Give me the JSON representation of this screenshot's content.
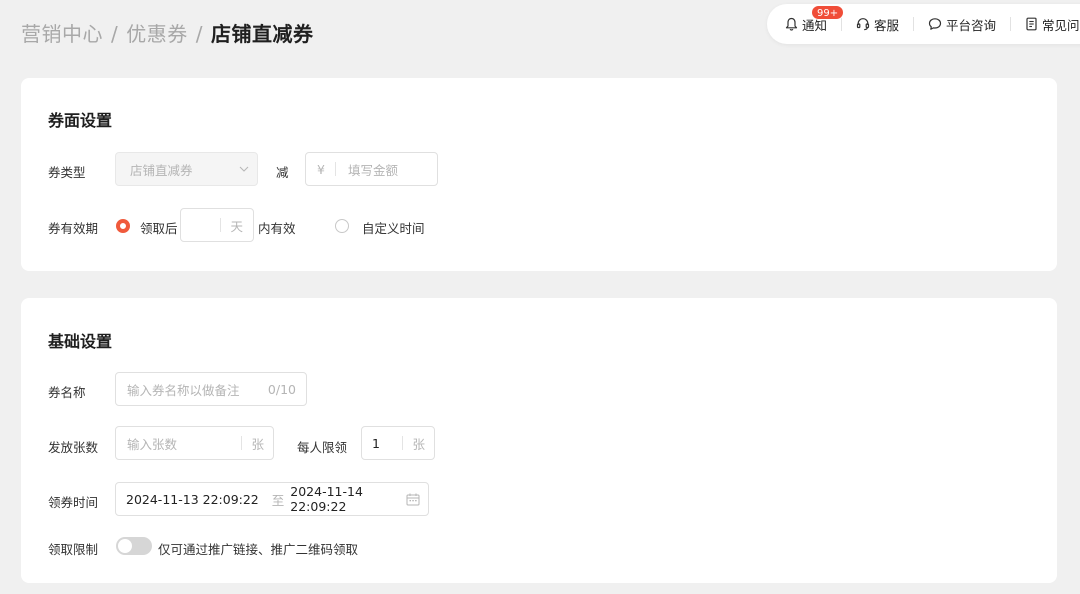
{
  "breadcrumb": {
    "items": [
      "营销中心",
      "优惠券"
    ],
    "separator": "/",
    "current": "店铺直减券"
  },
  "toolbar": {
    "notify_label": "通知",
    "notify_badge": "99+",
    "service_label": "客服",
    "consult_label": "平台咨询",
    "faq_label": "常见问题"
  },
  "coupon_face": {
    "title": "券面设置",
    "type_label": "券类型",
    "type_value": "店铺直减券",
    "reduce_label": "减",
    "currency_symbol": "¥",
    "amount_placeholder": "填写金额",
    "validity_label": "券有效期",
    "option_after_receive": "领取后",
    "days_unit": "天",
    "valid_within": "内有效",
    "option_custom": "自定义时间"
  },
  "basic": {
    "title": "基础设置",
    "name_label": "券名称",
    "name_placeholder": "输入券名称以做备注",
    "name_counter": "0/10",
    "count_label": "发放张数",
    "count_placeholder": "输入张数",
    "count_unit": "张",
    "per_user_label": "每人限领",
    "per_user_value": "1",
    "per_user_unit": "张",
    "time_label": "领券时间",
    "time_start": "2024-11-13 22:09:22",
    "time_to": "至",
    "time_end": "2024-11-14 22:09:22",
    "limit_label": "领取限制",
    "limit_text": "仅可通过推广链接、推广二维码领取"
  },
  "colors": {
    "accent": "#f05a3c",
    "badge": "#f04d38",
    "background": "#f0f0f0"
  }
}
